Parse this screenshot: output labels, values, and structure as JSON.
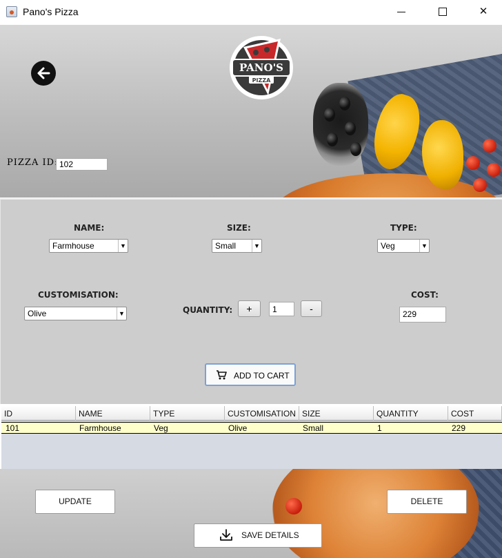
{
  "window": {
    "title": "Pano's Pizza",
    "minimize_glyph": "–",
    "maximize_glyph": "□",
    "close_glyph": "✕"
  },
  "logo": {
    "text": "PANO'S",
    "subtext": "PIZZA"
  },
  "pizza_id": {
    "label": "PIZZA ID:",
    "value": "102"
  },
  "form": {
    "name_label": "NAME:",
    "name_value": "Farmhouse",
    "size_label": "SIZE:",
    "size_value": "Small",
    "type_label": "TYPE:",
    "type_value": "Veg",
    "customisation_label": "CUSTOMISATION:",
    "customisation_value": "Olive",
    "quantity_label": "QUANTITY:",
    "quantity_value": "1",
    "plus_label": "+",
    "minus_label": "-",
    "cost_label": "COST:",
    "cost_value": "229",
    "add_to_cart_label": "ADD TO CART"
  },
  "table": {
    "columns": [
      "ID",
      "NAME",
      "TYPE",
      "CUSTOMISATION",
      "SIZE",
      "QUANTITY",
      "COST"
    ],
    "rows": [
      [
        "101",
        "Farmhouse",
        "Veg",
        "Olive",
        "Small",
        "1",
        "229"
      ]
    ]
  },
  "actions": {
    "update_label": "UPDATE",
    "delete_label": "DELETE",
    "save_label": "SAVE DETAILS"
  },
  "colors": {
    "form_panel": "#cdcdcd",
    "selected_row": "#ffffcc",
    "add_to_cart_border": "#7aa1d6",
    "logo_red": "#c8282a"
  }
}
